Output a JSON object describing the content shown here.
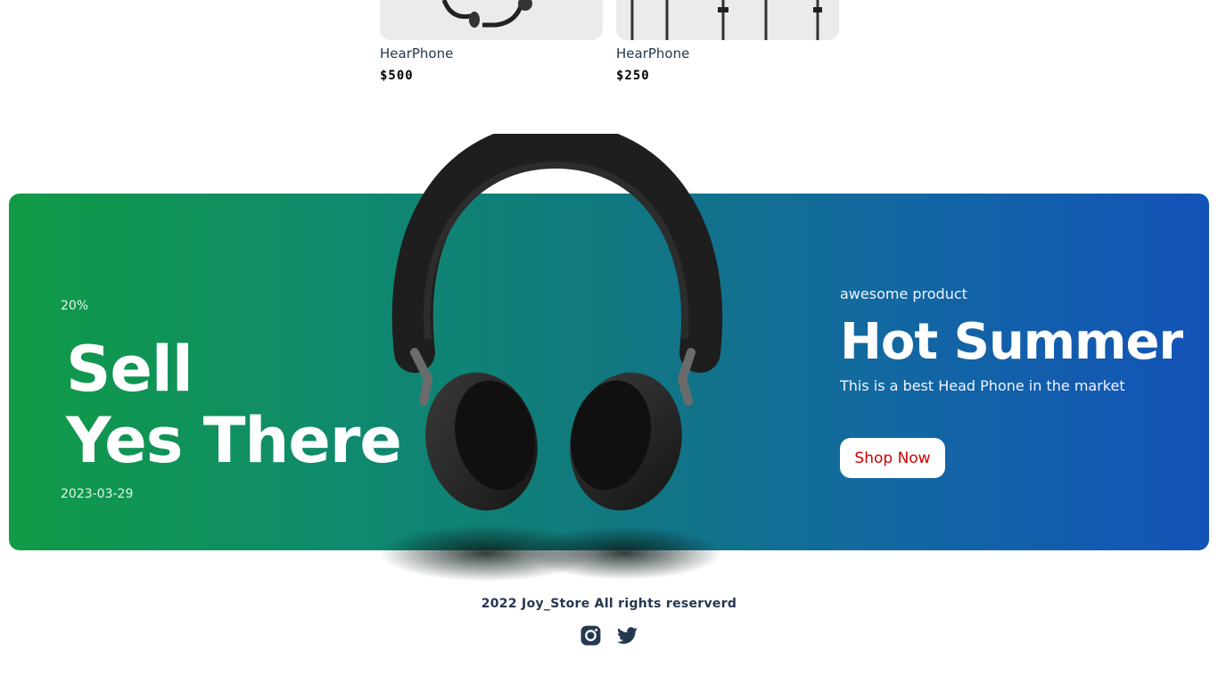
{
  "products": [
    {
      "name": "HearPhone",
      "price": "$500",
      "image_icon": "headset-icon"
    },
    {
      "name": "HearPhone",
      "price": "$250",
      "image_icon": "earphones-icon"
    }
  ],
  "banner": {
    "discount": "20%",
    "headline_line1": "Sell",
    "headline_line2": "Yes There",
    "date": "2023-03-29",
    "tagline": "awesome product",
    "title": "Hot Summer",
    "description": "This is a best Head Phone in the market",
    "cta_label": "Shop Now",
    "image_icon": "headphones-icon",
    "gradient_start": "#119b45",
    "gradient_end": "#1353b8",
    "cta_color": "#d10000"
  },
  "footer": {
    "copyright": "2022 Joy_Store All rights reserverd",
    "social": [
      "instagram-icon",
      "twitter-icon"
    ]
  }
}
